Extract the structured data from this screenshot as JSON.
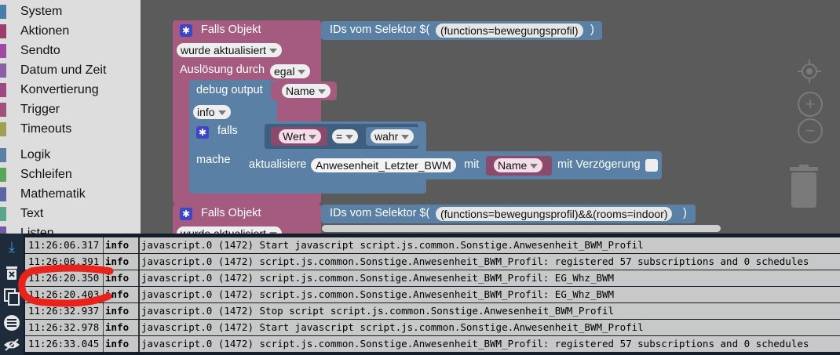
{
  "toolbox": {
    "items": [
      {
        "label": "System",
        "color": "#4a7ea8"
      },
      {
        "label": "Aktionen",
        "color": "#9b3d6e"
      },
      {
        "label": "Sendto",
        "color": "#9e4aa0"
      },
      {
        "label": "Datum und Zeit",
        "color": "#8a5fa8"
      },
      {
        "label": "Konvertierung",
        "color": "#9e4a80"
      },
      {
        "label": "Trigger",
        "color": "#a0507a"
      },
      {
        "label": "Timeouts",
        "color": "#a0a050"
      },
      {
        "label": "Logik",
        "color": "#5b80a5"
      },
      {
        "label": "Schleifen",
        "color": "#5ba55b"
      },
      {
        "label": "Mathematik",
        "color": "#5b67a5"
      },
      {
        "label": "Text",
        "color": "#5ba58c"
      },
      {
        "label": "Listen",
        "color": "#745ba5"
      }
    ]
  },
  "blocks": {
    "b1": {
      "title": "Falls Objekt",
      "selector_label": "IDs vom Selektor $(",
      "selector_value": "(functions=bewegungsprofil)",
      "selector_close": ")",
      "event_dd": "wurde aktualisiert",
      "trigger_label": "Auslösung durch",
      "trigger_dd": "egal",
      "debug_label": "debug output",
      "debug_value": "Name",
      "debug_level": "info",
      "if_label": "falls",
      "if_left": "Wert",
      "if_op": "=",
      "if_right": "wahr",
      "do_label": "mache",
      "update_label": "aktualisiere",
      "update_target": "Anwesenheit_Letzter_BWM",
      "update_with": "mit",
      "update_value": "Name",
      "update_delay": "mit Verzögerung"
    },
    "b2": {
      "title": "Falls Objekt",
      "selector_label": "IDs vom Selektor $(",
      "selector_value": "(functions=bewegungsprofil)&&(rooms=indoor)",
      "selector_close": ")",
      "event_dd": "wurde aktualisiert"
    }
  },
  "controls": {
    "center_icon": "crosshair-icon",
    "zoom_in": "+",
    "zoom_out": "−",
    "trash_icon": "trash-icon"
  },
  "log": {
    "sidebar_icons": [
      "download-icon",
      "clear-log-icon",
      "copy-icon",
      "toggle-panel-icon",
      "hide-icon"
    ],
    "rows": [
      {
        "time": "11:26:06.317",
        "level": "info",
        "msg": "javascript.0 (1472) Start javascript script.js.common.Sonstige.Anwesenheit_BWM_Profil"
      },
      {
        "time": "11:26:06.391",
        "level": "info",
        "msg": "javascript.0 (1472) script.js.common.Sonstige.Anwesenheit_BWM_Profil: registered 57 subscriptions and 0 schedules"
      },
      {
        "time": "11:26:20.350",
        "level": "info",
        "msg": "javascript.0 (1472) script.js.common.Sonstige.Anwesenheit_BWM_Profil: EG_Whz_BWM"
      },
      {
        "time": "11:26:20.403",
        "level": "info",
        "msg": "javascript.0 (1472) script.js.common.Sonstige.Anwesenheit_BWM_Profil: EG_Whz_BWM"
      },
      {
        "time": "11:26:32.937",
        "level": "info",
        "msg": "javascript.0 (1472) Stop script script.js.common.Sonstige.Anwesenheit_BWM_Profil"
      },
      {
        "time": "11:26:32.978",
        "level": "info",
        "msg": "javascript.0 (1472) Start javascript script.js.common.Sonstige.Anwesenheit_BWM_Profil"
      },
      {
        "time": "11:26:33.045",
        "level": "info",
        "msg": "javascript.0 (1472) script.js.common.Sonstige.Anwesenheit_BWM_Profil: registered 57 subscriptions and 0 schedules"
      }
    ]
  }
}
